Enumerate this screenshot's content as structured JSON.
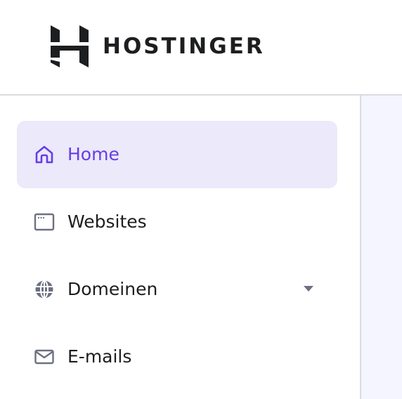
{
  "brand": {
    "name": "HOSTINGER",
    "accent_color": "#673de6",
    "text_color": "#1d1e20"
  },
  "sidebar": {
    "items": [
      {
        "label": "Home",
        "icon": "home-icon",
        "active": true
      },
      {
        "label": "Websites",
        "icon": "browser-window-icon",
        "active": false
      },
      {
        "label": "Domeinen",
        "icon": "globe-icon",
        "active": false,
        "expandable": true
      },
      {
        "label": "E-mails",
        "icon": "mail-icon",
        "active": false
      }
    ]
  }
}
